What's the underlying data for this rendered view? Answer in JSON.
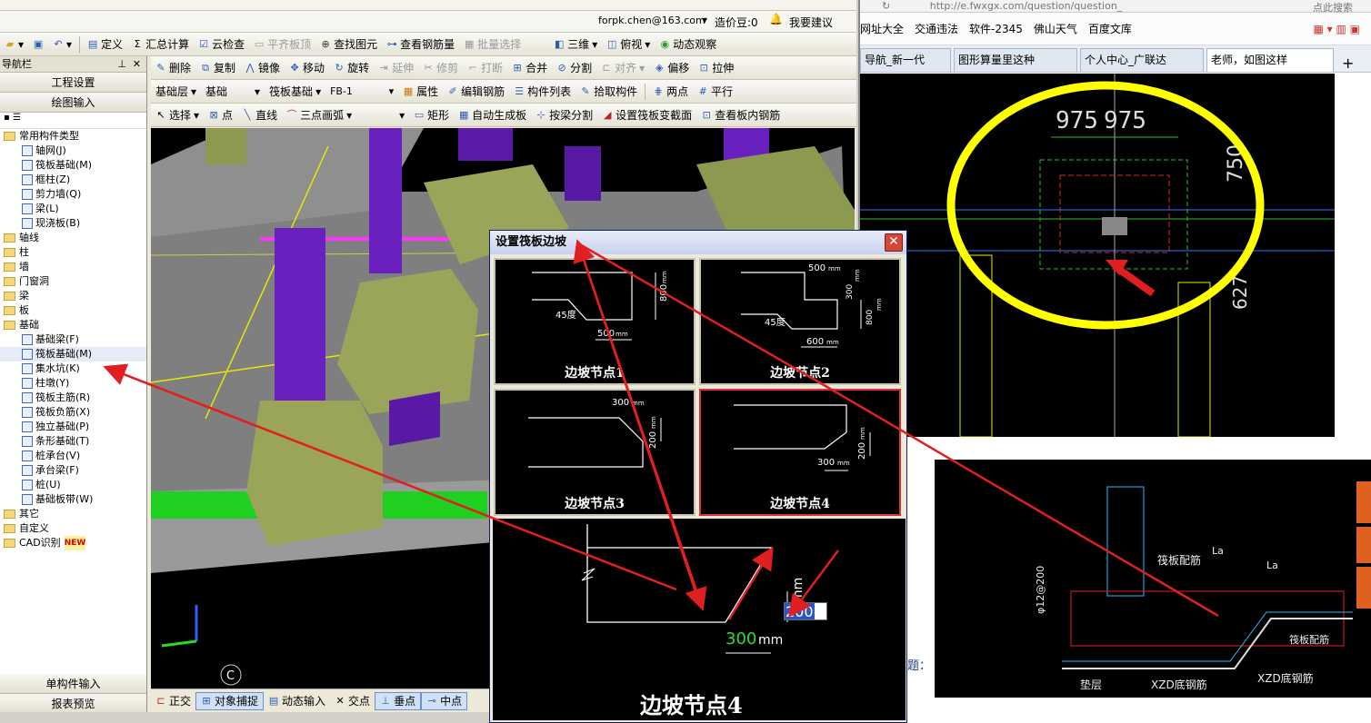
{
  "account": {
    "email": "forpk.chen@163.com",
    "credit": "造价豆:0",
    "suggest": "我要建议"
  },
  "toolbar1": {
    "define": "定义",
    "sum": "汇总计算",
    "cloud": "云检查",
    "flat": "平齐板顶",
    "find": "查找图元",
    "view_rebar": "查看钢筋量",
    "batch": "批量选择",
    "view3d": "三维",
    "overlook": "俯视",
    "dyn": "动态观察"
  },
  "toolbar2": {
    "delete": "删除",
    "copy": "复制",
    "mirror": "镜像",
    "move": "移动",
    "rotate": "旋转",
    "extend": "延伸",
    "trim": "修剪",
    "break": "打断",
    "merge": "合并",
    "split": "分割",
    "align": "对齐",
    "offset": "偏移",
    "stretch": "拉伸"
  },
  "toolbar3": {
    "layer": "基础层",
    "category": "基础",
    "type": "筏板基础",
    "item": "FB-1",
    "props": "属性",
    "edit_rebar": "编辑钢筋",
    "list": "构件列表",
    "pick": "拾取构件",
    "twopoint": "两点",
    "parallel": "平行"
  },
  "toolbar4": {
    "select": "选择",
    "point": "点",
    "line": "直线",
    "arc": "三点画弧",
    "rect": "矩形",
    "auto": "自动生成板",
    "beam_split": "按梁分割",
    "set_slope": "设置筏板变截面",
    "view_inner": "查看板内钢筋"
  },
  "nav": {
    "title": "导航栏",
    "project": "工程设置",
    "draw": "绘图输入",
    "single": "单构件输入",
    "report": "报表预览",
    "tree": [
      {
        "label": "常用构件类型",
        "level": 0,
        "folder": true
      },
      {
        "label": "轴网(J)",
        "level": 1
      },
      {
        "label": "筏板基础(M)",
        "level": 1
      },
      {
        "label": "框柱(Z)",
        "level": 1
      },
      {
        "label": "剪力墙(Q)",
        "level": 1
      },
      {
        "label": "梁(L)",
        "level": 1
      },
      {
        "label": "现浇板(B)",
        "level": 1
      },
      {
        "label": "轴线",
        "level": 0,
        "folder": true
      },
      {
        "label": "柱",
        "level": 0,
        "folder": true
      },
      {
        "label": "墙",
        "level": 0,
        "folder": true
      },
      {
        "label": "门窗洞",
        "level": 0,
        "folder": true
      },
      {
        "label": "梁",
        "level": 0,
        "folder": true
      },
      {
        "label": "板",
        "level": 0,
        "folder": true
      },
      {
        "label": "基础",
        "level": 0,
        "folder": true
      },
      {
        "label": "基础梁(F)",
        "level": 1
      },
      {
        "label": "筏板基础(M)",
        "level": 1
      },
      {
        "label": "集水坑(K)",
        "level": 1
      },
      {
        "label": "柱墩(Y)",
        "level": 1
      },
      {
        "label": "筏板主筋(R)",
        "level": 1
      },
      {
        "label": "筏板负筋(X)",
        "level": 1
      },
      {
        "label": "独立基础(P)",
        "level": 1
      },
      {
        "label": "条形基础(T)",
        "level": 1
      },
      {
        "label": "桩承台(V)",
        "level": 1
      },
      {
        "label": "承台梁(F)",
        "level": 1
      },
      {
        "label": "桩(U)",
        "level": 1
      },
      {
        "label": "基础板带(W)",
        "level": 1
      },
      {
        "label": "其它",
        "level": 0,
        "folder": true
      },
      {
        "label": "自定义",
        "level": 0,
        "folder": true
      },
      {
        "label": "CAD识别",
        "level": 0,
        "folder": true
      }
    ],
    "new_badge": "NEW"
  },
  "status": {
    "ortho": "正交",
    "snap": "对象捕捉",
    "dyn_input": "动态输入",
    "intersect": "交点",
    "perp": "垂点",
    "mid": "中点"
  },
  "browser": {
    "url": "http://e.fwxgx.com/question/question_",
    "search": "点此搜索",
    "favorites": [
      "网址大全",
      "交通违法",
      "软件-2345",
      "佛山天气",
      "百度文库"
    ],
    "tabs": [
      "导航_新一代",
      "图形算量里这种",
      "个人中心_广联达",
      "老师，如图这样"
    ],
    "q_char": "题："
  },
  "cad_top": {
    "dim1": "975",
    "dim2": "975",
    "dim3": "750",
    "dim4": "627"
  },
  "cad_bottom": {
    "l1": "筏板配筋",
    "l2": "La",
    "l3": "La",
    "l4": "φ12@200",
    "l5": "筏板配筋",
    "l6": "XZD底钢筋",
    "l7": "垫层",
    "l8": "XZD底钢筋"
  },
  "dialog": {
    "title": "设置筏板边坡",
    "close": "✕",
    "nodes": [
      {
        "label": "边坡节点1",
        "deg": "45度",
        "w": "500",
        "h": "800",
        "unit": "mm"
      },
      {
        "label": "边坡节点2",
        "deg": "45度",
        "w": "600",
        "top": "500",
        "h1": "300",
        "h2": "800",
        "unit": "mm"
      },
      {
        "label": "边坡节点3",
        "w": "300",
        "h": "200",
        "unit": "mm"
      },
      {
        "label": "边坡节点4",
        "w": "300",
        "h": "200",
        "unit": "mm"
      }
    ],
    "big": {
      "label": "边坡节点4",
      "w": "300",
      "unit": "mm",
      "input": "200",
      "vunit": "mm"
    }
  },
  "colors": {
    "accent": "#e02020",
    "highlight": "#ffff00",
    "cad_green": "#00ff00"
  }
}
